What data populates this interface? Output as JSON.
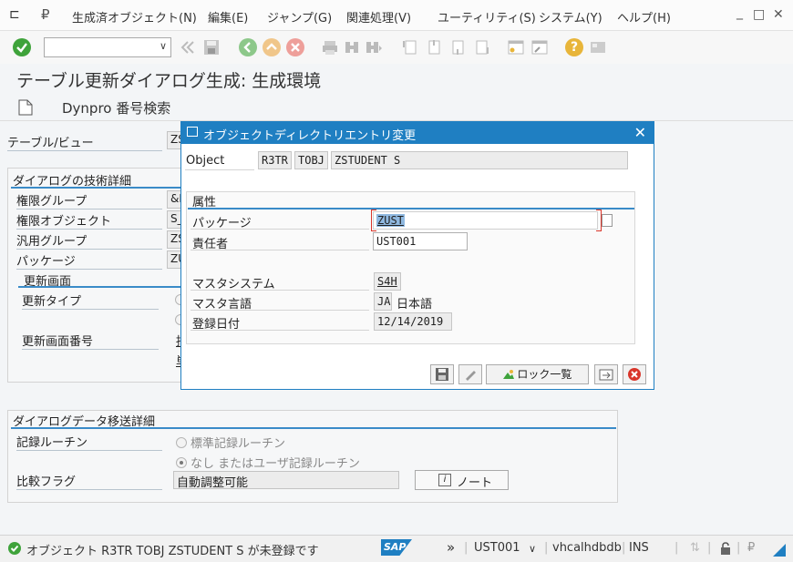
{
  "menubar": {
    "items": [
      "生成済オブジェクト(N)",
      "編集(E)",
      "ジャンプ(G)",
      "関連処理(V)",
      "ユーティリティ(S)",
      "システム(Y)",
      "ヘルプ(H)"
    ]
  },
  "window_controls": {
    "minimize": "_",
    "maximize": "□",
    "close": "✕"
  },
  "page": {
    "title": "テーブル更新ダイアログ生成: 生成環境",
    "appbar_action": "Dynpro 番号検索"
  },
  "form": {
    "table_view_label": "テーブル/ビュー",
    "table_view_value": "ZS",
    "tech_section": "ダイアログの技術詳細",
    "auth_group_label": "権限グループ",
    "auth_group_value": "&N",
    "auth_object_label": "権限オブジェクト",
    "auth_object_value": "S_",
    "func_group_label": "汎用グループ",
    "func_group_value": "ZS",
    "package_label": "パッケージ",
    "package_value": "ZU",
    "maint_screen_section": "更新画面",
    "maint_type_label": "更新タイプ",
    "maint_screen_no_label": "更新画面番号",
    "maint_screen_no_value1": "抽",
    "maint_screen_no_value2": "単",
    "transfer_section": "ダイアログデータ移送詳細",
    "record_routine_label": "記録ルーチン",
    "radio_standard": "標準記録ルーチン",
    "radio_none": "なし またはユーザ記録ルーチン",
    "compare_flag_label": "比較フラグ",
    "compare_flag_value": "自動調整可能",
    "note_button": "ノート",
    "note_icon": "i"
  },
  "dialog": {
    "title": "オブジェクトディレクトリエントリ変更",
    "object_label": "Object",
    "object_pgmid": "R3TR",
    "object_type": "TOBJ",
    "object_name": "ZSTUDENT",
    "object_suffix": "S",
    "attributes_section": "属性",
    "package_label": "パッケージ",
    "package_value": "ZUST",
    "responsible_label": "責任者",
    "responsible_value": "UST001",
    "master_system_label": "マスタシステム",
    "master_system_value": "S4H",
    "master_lang_label": "マスタ言語",
    "master_lang_code": "JA",
    "master_lang_name": "日本語",
    "created_label": "登録日付",
    "created_value": "12/14/2019",
    "lock_overview_button": "ロック一覧"
  },
  "statusbar": {
    "message": "オブジェクト R3TR TOBJ ZSTUDENT S が未登録です",
    "brand": "SAP",
    "user": "UST001",
    "host": "vhcalhdbdb",
    "mode": "INS"
  },
  "colors": {
    "accent": "#1f7fc2",
    "ok_green": "#3fa33b",
    "cancel_red": "#d9362b",
    "help_yellow": "#e8b53a"
  }
}
